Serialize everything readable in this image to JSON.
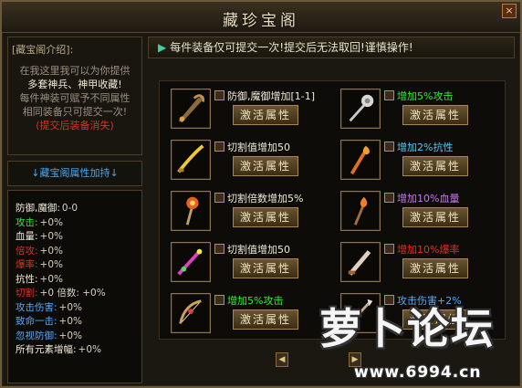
{
  "window": {
    "title": "藏珍宝阁",
    "close_label": "×"
  },
  "intro": {
    "title": "[藏宝阁介绍]:",
    "lines": [
      {
        "text": "在我这里我可以为你提供",
        "color": "#9a9080"
      },
      {
        "text": "多套神兵、神甲收藏!",
        "color": "#f0ead8"
      },
      {
        "text": "每件神装可赋予不同属性",
        "color": "#9a9080"
      },
      {
        "text": "相同装备只可提交一次!",
        "color": "#9a9080"
      },
      {
        "text": "(提交后装备消失)",
        "color": "#e03020"
      }
    ]
  },
  "bonus_header": "↓藏宝阁属性加持↓",
  "stats": [
    {
      "label": "防御,魔御:",
      "value": "0-0",
      "color": "#f0ead8"
    },
    {
      "label": "攻击:",
      "value": "+0%",
      "color": "#38e838"
    },
    {
      "label": "血量:",
      "value": "+0%",
      "color": "#f0ead8"
    },
    {
      "label": "倍攻:",
      "value": "+0%",
      "color": "#e03020"
    },
    {
      "label": "爆率:",
      "value": "+0%",
      "color": "#e03020"
    },
    {
      "label": "抗性:",
      "value": "+0%",
      "color": "#f0ead8"
    },
    {
      "label": "切割:",
      "value": "+0 倍数: +0%",
      "color": "#e03020"
    },
    {
      "label": "攻击伤害:",
      "value": "+0%",
      "color": "#58a8f8"
    },
    {
      "label": "致命一击:",
      "value": "+0%",
      "color": "#58a8f8"
    },
    {
      "label": "忽视防御:",
      "value": "+0%",
      "color": "#58a8f8"
    },
    {
      "label": "所有元素增幅:",
      "value": "+0%",
      "color": "#f0ead8"
    }
  ],
  "notice": "每件装备仅可提交一次!提交后无法取回!谨慎操作!",
  "activate_label": "激活属性",
  "items": [
    {
      "name": "防御,魔御增加[1-1]",
      "color": "#f0ead8",
      "icon": "dragon-blade-icon",
      "col": 0,
      "row": 0
    },
    {
      "name": "增加5%攻击",
      "color": "#38e838",
      "icon": "mace-icon",
      "col": 1,
      "row": 0
    },
    {
      "name": "切割值增加50",
      "color": "#f0ead8",
      "icon": "golden-sabre-icon",
      "col": 0,
      "row": 1
    },
    {
      "name": "增加2%抗性",
      "color": "#58c8f8",
      "icon": "flame-staff-icon",
      "col": 1,
      "row": 1
    },
    {
      "name": "切割倍数增加5%",
      "color": "#f0ead8",
      "icon": "fire-orb-staff-icon",
      "col": 0,
      "row": 2
    },
    {
      "name": "增加10%血量",
      "color": "#c878f0",
      "icon": "torch-staff-icon",
      "col": 1,
      "row": 2
    },
    {
      "name": "切割值增加50",
      "color": "#f0ead8",
      "icon": "jeweled-blade-icon",
      "col": 0,
      "row": 3
    },
    {
      "name": "增加10%爆率",
      "color": "#e03020",
      "icon": "war-blade-icon",
      "col": 1,
      "row": 3
    },
    {
      "name": "增加5%攻击",
      "color": "#38e838",
      "icon": "bow-icon",
      "col": 0,
      "row": 4
    },
    {
      "name": "攻击伤害+2%",
      "color": "#58a8f8",
      "icon": "spear-icon",
      "col": 1,
      "row": 4
    }
  ],
  "pager": {
    "prev": "◀",
    "next": "▶"
  },
  "watermark": {
    "text": "萝卜论坛",
    "url": "www.6994.cn"
  }
}
